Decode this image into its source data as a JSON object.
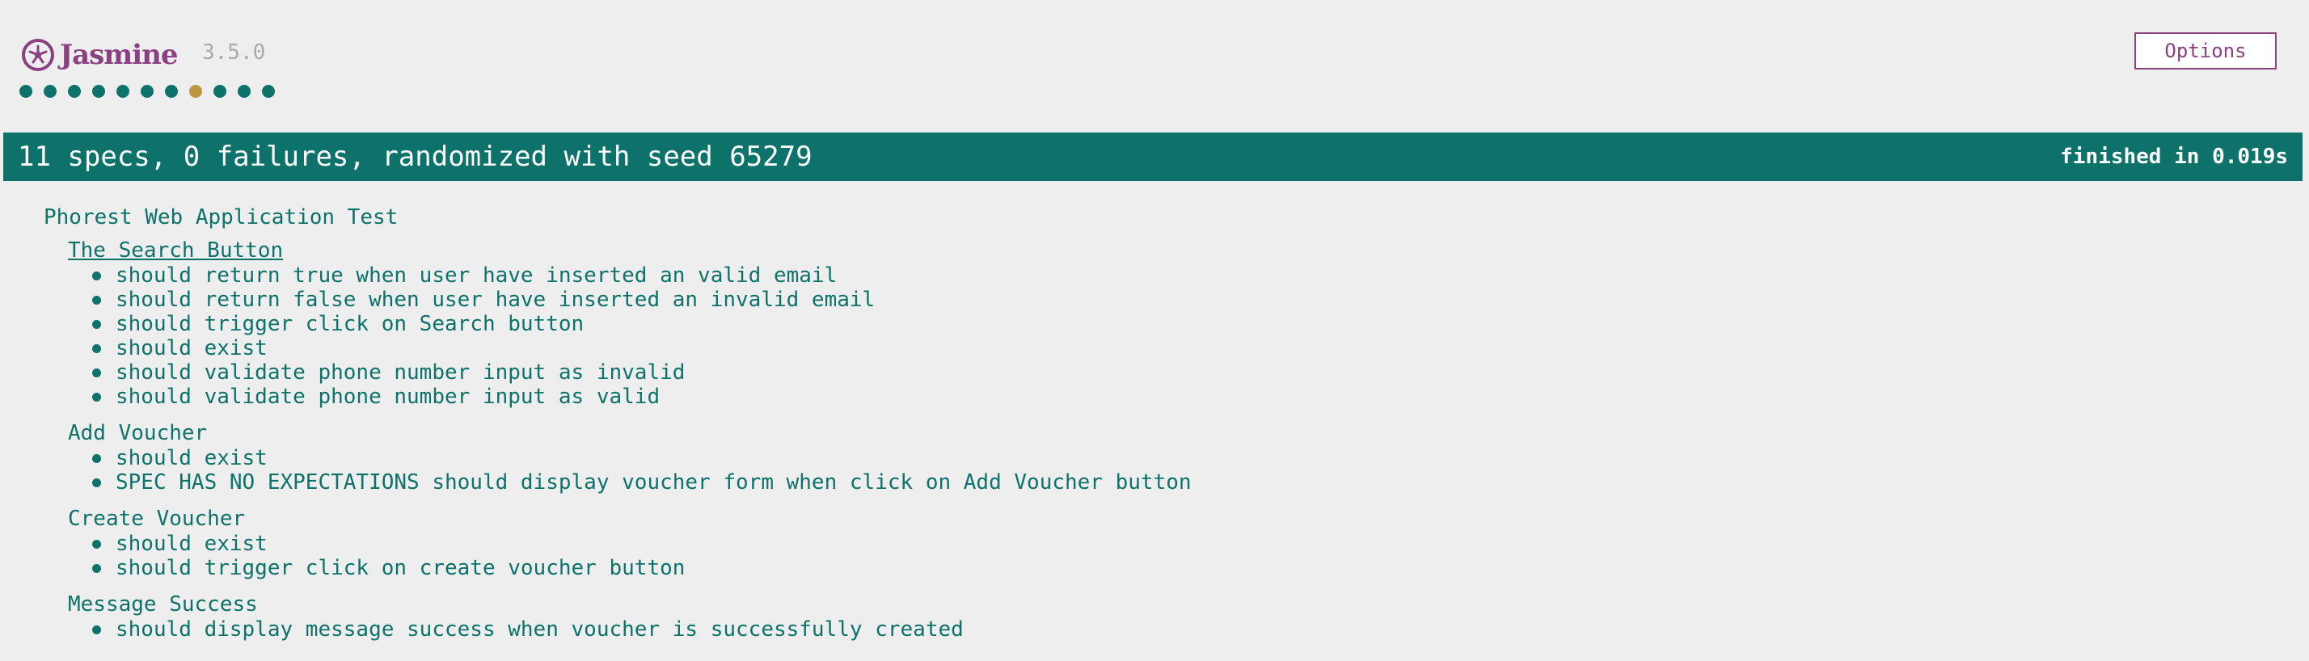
{
  "app": {
    "name": "Jasmine",
    "version": "3.5.0",
    "logo_icon": "jasmine-flower-icon",
    "brand_color": "#8a4182"
  },
  "header": {
    "options_label": "Options"
  },
  "spec_dots": [
    {
      "status": "passed",
      "color": "#0d726a"
    },
    {
      "status": "passed",
      "color": "#0d726a"
    },
    {
      "status": "passed",
      "color": "#0d726a"
    },
    {
      "status": "passed",
      "color": "#0d726a"
    },
    {
      "status": "passed",
      "color": "#0d726a"
    },
    {
      "status": "passed",
      "color": "#0d726a"
    },
    {
      "status": "passed",
      "color": "#0d726a"
    },
    {
      "status": "empty",
      "color": "#bc9640"
    },
    {
      "status": "passed",
      "color": "#0d726a"
    },
    {
      "status": "passed",
      "color": "#0d726a"
    },
    {
      "status": "passed",
      "color": "#0d726a"
    }
  ],
  "summary": {
    "text": "11 specs, 0 failures, randomized with seed 65279",
    "duration": "finished in 0.019s",
    "bar_color": "#0d726a"
  },
  "results": {
    "root_suite": "Phorest Web Application Test",
    "suites": [
      {
        "title": "The Search Button",
        "specs": [
          "should return true when user have inserted an valid email",
          "should return false when user have inserted an invalid email",
          "should trigger click on Search button",
          "should exist",
          "should validate phone number input as invalid",
          "should validate phone number input as valid"
        ]
      },
      {
        "title": "Add Voucher",
        "specs": [
          "should exist",
          "SPEC HAS NO EXPECTATIONS should display voucher form when click on Add Voucher button"
        ]
      },
      {
        "title": "Create Voucher",
        "specs": [
          "should exist",
          "should trigger click on create voucher button"
        ]
      },
      {
        "title": "Message Success",
        "specs": [
          "should display message success when voucher is successfully created"
        ]
      }
    ]
  }
}
